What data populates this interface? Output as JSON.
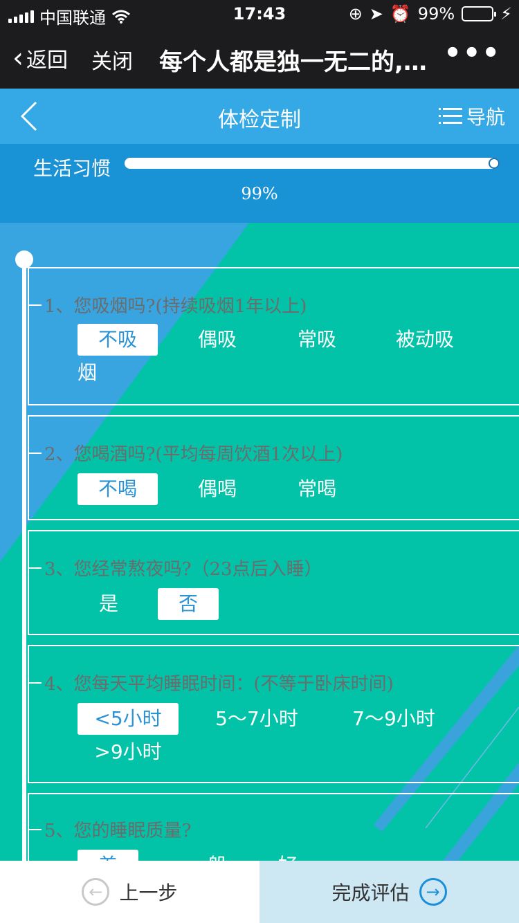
{
  "status": {
    "carrier": "中国联通",
    "time": "17:43",
    "battery": "99%"
  },
  "wechat": {
    "back_label": "返回",
    "close_label": "关闭",
    "title": "每个人都是独一无二的,…",
    "more_label": "•••"
  },
  "header": {
    "title": "体检定制",
    "nav_label": "导航"
  },
  "progress": {
    "section": "生活习惯",
    "percent_text": "99%",
    "value": 0.99
  },
  "questions": [
    {
      "text": "1、您吸烟吗?(持续吸烟1年以上)",
      "options": [
        "不吸",
        "偶吸",
        "常吸",
        "被动吸",
        "烟"
      ],
      "selected": 0
    },
    {
      "text": "2、您喝酒吗?(平均每周饮酒1次以上)",
      "options": [
        "不喝",
        "偶喝",
        "常喝"
      ],
      "selected": 0
    },
    {
      "text": "3、您经常熬夜吗?（23点后入睡）",
      "options": [
        "是",
        "否"
      ],
      "selected": 1
    },
    {
      "text": "4、您每天平均睡眠时间：(不等于卧床时间)",
      "options": [
        "<5小时",
        "5～7小时",
        "7～9小时",
        ">9小时"
      ],
      "selected": 0
    },
    {
      "text": "5、您的睡眠质量?",
      "options": [
        "差",
        "一般",
        "好"
      ],
      "selected": 0
    }
  ],
  "footer": {
    "prev_label": "上一步",
    "finish_label": "完成评估"
  },
  "colors": {
    "teal": "#02c3a8",
    "blue_header": "#35a9e5",
    "blue_progress": "#1a93d6"
  }
}
